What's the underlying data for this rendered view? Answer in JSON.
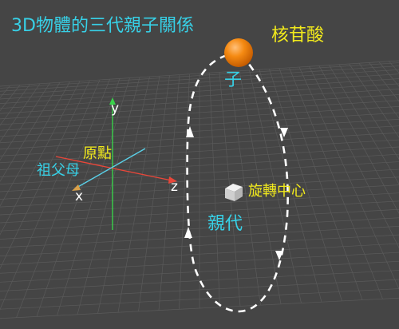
{
  "scene": {
    "title": "3D物體的三代親子關係",
    "top_label": "核苷酸",
    "child_label": "子",
    "parent_label": "親代",
    "rotation_center_label": "旋轉中心",
    "origin_label": "原點",
    "grandparent_label": "祖父母",
    "axis_x": "x",
    "axis_y": "y",
    "axis_z": "z"
  },
  "colors": {
    "background": "#454545",
    "grid": "#5a5a5a",
    "title": "#37d0e6",
    "top_label": "#f2ea1c",
    "child_label": "#37d0e6",
    "parent_label": "#37d0e6",
    "rotation_center_label": "#f2ea1c",
    "origin_label": "#f2ea1c",
    "grandparent_label": "#37d0e6",
    "axis_x": "#d8a04a",
    "axis_y": "#39d14a",
    "axis_z": "#e8473a",
    "sphere": "#f58a12",
    "orbit": "#ffffff"
  },
  "icons": {
    "sphere": "orange-sphere-icon",
    "cube": "cube-icon"
  }
}
